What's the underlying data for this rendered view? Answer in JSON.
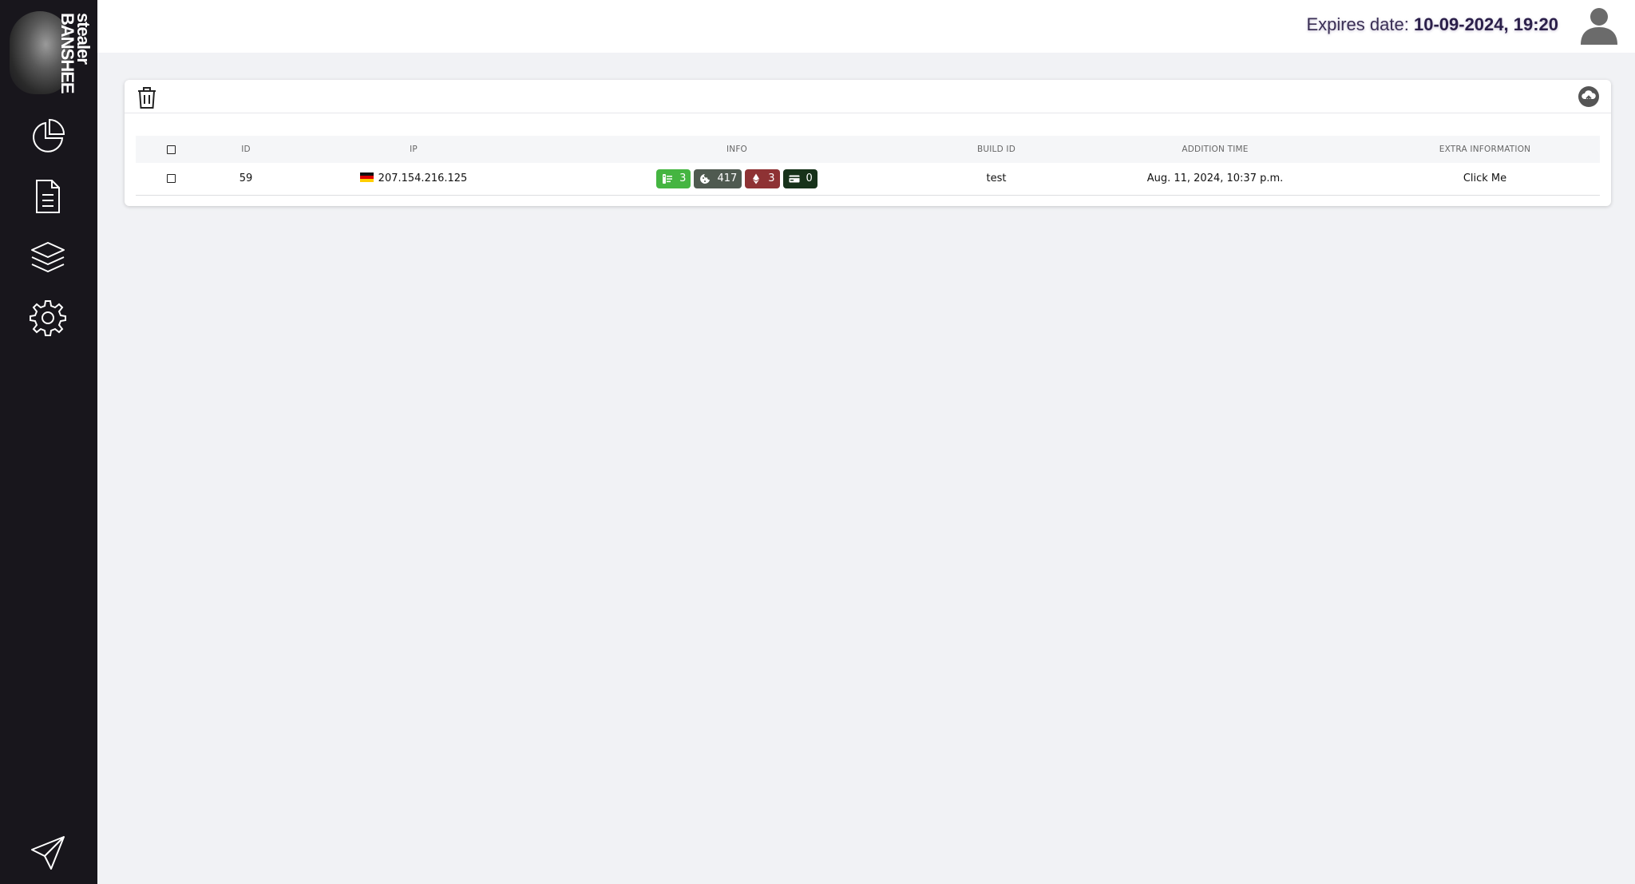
{
  "brand": {
    "logo_text": "stealer\nBANSHEE"
  },
  "sidebar": {
    "items": [
      {
        "name": "dashboard",
        "icon": "pie-chart-icon"
      },
      {
        "name": "logs",
        "icon": "document-icon"
      },
      {
        "name": "builds",
        "icon": "layers-icon"
      },
      {
        "name": "settings",
        "icon": "gear-icon"
      }
    ],
    "bottom": {
      "icon": "send-icon"
    }
  },
  "header": {
    "expires_label": "Expires date:",
    "expires_value": "10-09-2024, 19:20"
  },
  "toolbar": {
    "delete_icon": "trash-icon",
    "upload_icon": "cloud-upload-icon"
  },
  "table": {
    "columns": [
      "ID",
      "IP",
      "INFO",
      "BUILD ID",
      "ADDITION TIME",
      "EXTRA INFORMATION"
    ],
    "rows": [
      {
        "id": "59",
        "ip": "207.154.216.125",
        "country_flag": "germany-flag",
        "info": [
          {
            "icon": "key-icon",
            "count": "3",
            "color": "#45b541"
          },
          {
            "icon": "cookie-icon",
            "count": "417",
            "color": "#4f5a50"
          },
          {
            "icon": "ethereum-icon",
            "count": "3",
            "color": "#8e3234"
          },
          {
            "icon": "card-icon",
            "count": "0",
            "color": "#17321a"
          }
        ],
        "build_id": "test",
        "addition_time": "Aug. 11, 2024, 10:37 p.m.",
        "extra": "Click Me"
      }
    ]
  }
}
